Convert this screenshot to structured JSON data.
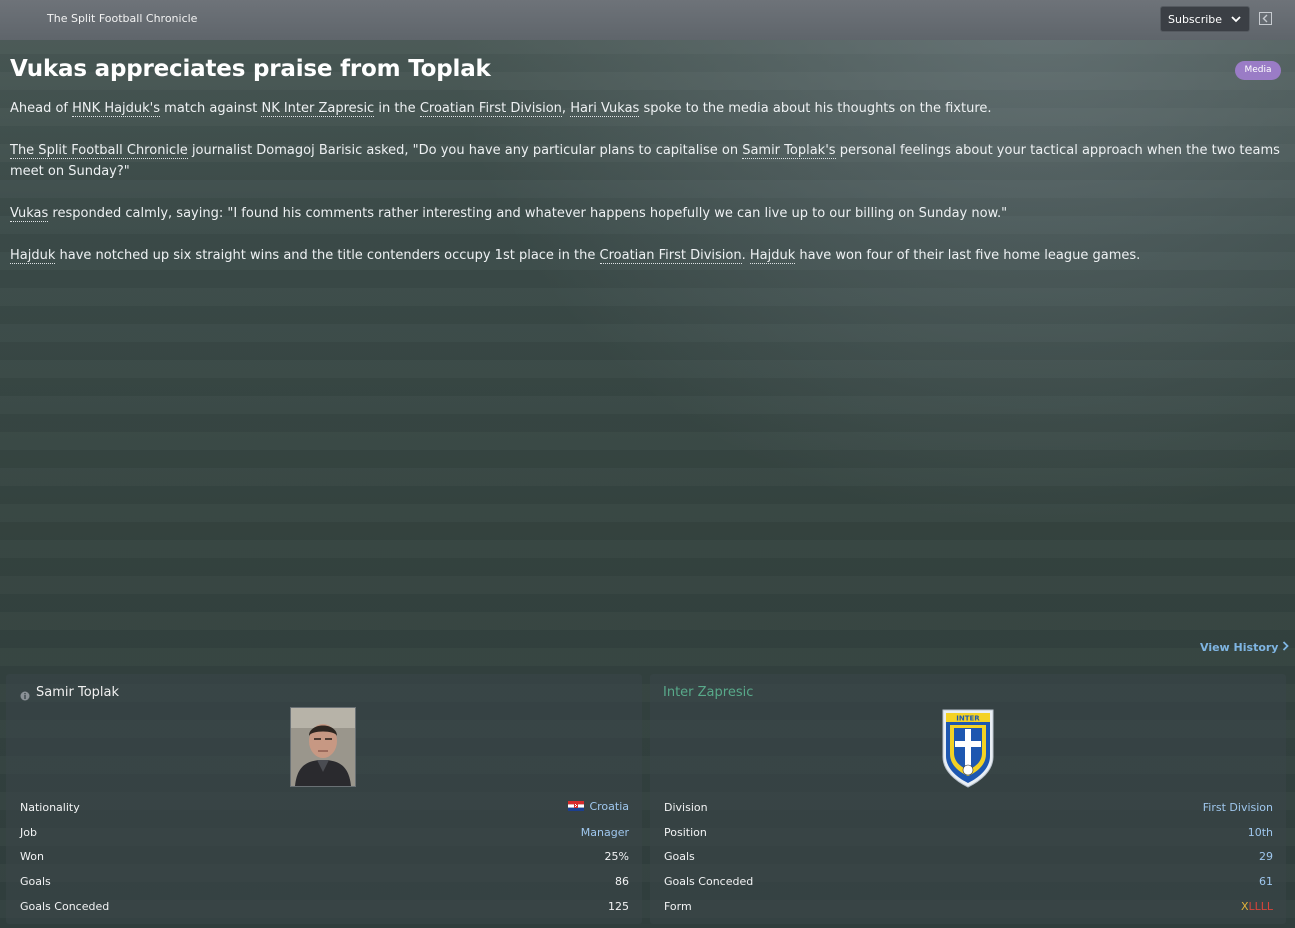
{
  "topbar": {
    "source": "The Split Football Chronicle",
    "subscribe_label": "Subscribe"
  },
  "article": {
    "headline": "Vukas appreciates praise from Toplak",
    "badge": "Media",
    "p1": {
      "t1": "Ahead of ",
      "l1": "HNK Hajduk's",
      "t2": " match against ",
      "l2": "NK Inter Zapresic",
      "t3": " in the ",
      "l3": "Croatian First Division",
      "t4": ", ",
      "l4": "Hari Vukas",
      "t5": " spoke to the media about his thoughts on the fixture."
    },
    "p2": {
      "l1": "The Split Football Chronicle",
      "t1": " journalist Domagoj Barisic asked, \"Do you have any particular plans to capitalise on ",
      "l2": "Samir Toplak's",
      "t2": " personal feelings about your tactical approach when the two teams meet on Sunday?\""
    },
    "p3": {
      "l1": "Vukas",
      "t1": " responded calmly, saying: \"I found his comments rather interesting and whatever happens hopefully we can live up to our billing on Sunday now.\""
    },
    "p4": {
      "l1": "Hajduk",
      "t1": " have notched up six straight wins and the title contenders occupy 1st place in the ",
      "l2": "Croatian First Division",
      "t2": ". ",
      "l3": "Hajduk",
      "t3": " have won four of their last five home league games."
    }
  },
  "view_history": "View History",
  "person_card": {
    "name": "Samir Toplak",
    "rows": {
      "nationality": {
        "label": "Nationality",
        "value": "Croatia"
      },
      "job": {
        "label": "Job",
        "value": "Manager"
      },
      "won": {
        "label": "Won",
        "value": "25%"
      },
      "goals": {
        "label": "Goals",
        "value": "86"
      },
      "conceded": {
        "label": "Goals Conceded",
        "value": "125"
      }
    }
  },
  "club_card": {
    "name": "Inter Zapresic",
    "crest_text": "INTER",
    "rows": {
      "division": {
        "label": "Division",
        "value": "First Division"
      },
      "position": {
        "label": "Position",
        "value": "10th"
      },
      "goals": {
        "label": "Goals",
        "value": "29"
      },
      "conceded": {
        "label": "Goals Conceded",
        "value": "61"
      },
      "form": {
        "label": "Form",
        "value_first": "X",
        "value_rest": "LLLL"
      }
    }
  },
  "colors": {
    "accent_link": "#7fb5e3",
    "badge": "#9a7cc6",
    "club_name": "#58a98a",
    "form_draw": "#e2b23c",
    "form_loss": "#d7443a"
  }
}
